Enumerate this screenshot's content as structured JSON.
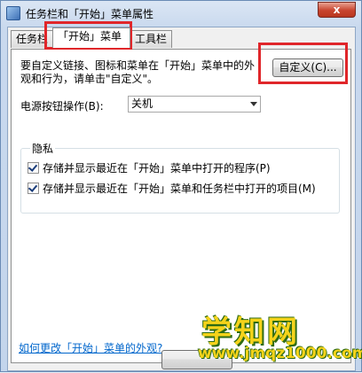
{
  "window": {
    "title": "任务栏和「开始」菜单属性",
    "close_glyph": "x"
  },
  "tabs": [
    "任务栏",
    "「开始」菜单",
    "工具栏"
  ],
  "start_menu": {
    "description": "要自定义链接、图标和菜单在「开始」菜单中的外观和行为，请单击\"自定义\"。",
    "customize_button": "自定义(C)...",
    "power_label": "电源按钮操作(B):",
    "power_value": "关机",
    "privacy": {
      "title": "隐私",
      "items": [
        {
          "label": "存储并显示最近在「开始」菜单中打开的程序(P)",
          "checked": true
        },
        {
          "label": "存储并显示最近在「开始」菜单和任务栏中打开的项目(M)",
          "checked": true
        }
      ]
    },
    "help_link": "如何更改「开始」菜单的外观?"
  },
  "watermark": {
    "line1": "学知网",
    "line2": "www.jmqz1000.com"
  },
  "colors": {
    "highlight": "#e0262a",
    "link": "#0066cc"
  }
}
